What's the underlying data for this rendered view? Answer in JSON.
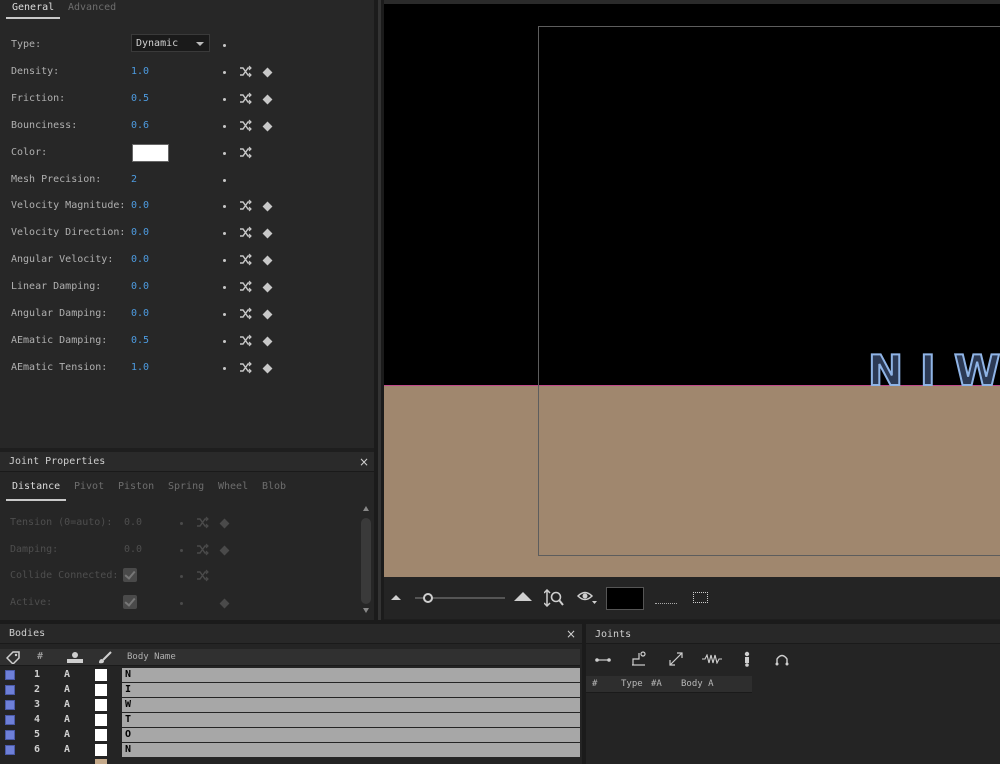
{
  "general_panel": {
    "tabs": [
      {
        "label": "General",
        "active": true
      },
      {
        "label": "Advanced",
        "active": false
      }
    ],
    "properties": [
      {
        "label": "Type:",
        "kind": "select",
        "value": "Dynamic",
        "shuffle": false,
        "keyframe": false
      },
      {
        "label": "Density:",
        "kind": "number",
        "value": "1.0",
        "shuffle": true,
        "keyframe": true
      },
      {
        "label": "Friction:",
        "kind": "number",
        "value": "0.5",
        "shuffle": true,
        "keyframe": true
      },
      {
        "label": "Bounciness:",
        "kind": "number",
        "value": "0.6",
        "shuffle": true,
        "keyframe": true
      },
      {
        "label": "Color:",
        "kind": "color",
        "value": "#ffffff",
        "shuffle": true,
        "keyframe": false
      },
      {
        "label": "Mesh Precision:",
        "kind": "number",
        "value": "2",
        "shuffle": false,
        "keyframe": false
      },
      {
        "label": "Velocity Magnitude:",
        "kind": "number",
        "value": "0.0",
        "shuffle": true,
        "keyframe": true
      },
      {
        "label": "Velocity Direction:",
        "kind": "number",
        "value": "0.0",
        "shuffle": true,
        "keyframe": true
      },
      {
        "label": "Angular Velocity:",
        "kind": "number",
        "value": "0.0",
        "shuffle": true,
        "keyframe": true
      },
      {
        "label": "Linear Damping:",
        "kind": "number",
        "value": "0.0",
        "shuffle": true,
        "keyframe": true
      },
      {
        "label": "Angular Damping:",
        "kind": "number",
        "value": "0.0",
        "shuffle": true,
        "keyframe": true
      },
      {
        "label": "AEmatic Damping:",
        "kind": "number",
        "value": "0.5",
        "shuffle": true,
        "keyframe": true
      },
      {
        "label": "AEmatic Tension:",
        "kind": "number",
        "value": "1.0",
        "shuffle": true,
        "keyframe": true
      }
    ]
  },
  "joint_panel": {
    "title": "Joint Properties",
    "close": "×",
    "tabs": [
      {
        "label": "Distance",
        "active": true
      },
      {
        "label": "Pivot",
        "active": false
      },
      {
        "label": "Piston",
        "active": false
      },
      {
        "label": "Spring",
        "active": false
      },
      {
        "label": "Wheel",
        "active": false
      },
      {
        "label": "Blob",
        "active": false
      }
    ],
    "properties": [
      {
        "label": "Tension (0=auto):",
        "kind": "number",
        "value": "0.0",
        "shuffle": true,
        "keyframe": true
      },
      {
        "label": "Damping:",
        "kind": "number",
        "value": "0.0",
        "shuffle": true,
        "keyframe": true
      },
      {
        "label": "Collide Connected:",
        "kind": "check",
        "value": "",
        "shuffle": true,
        "keyframe": false
      },
      {
        "label": "Active:",
        "kind": "check",
        "value": "",
        "shuffle": false,
        "keyframe": true
      }
    ]
  },
  "viewport": {
    "letters": [
      "N",
      "I",
      "W"
    ],
    "ground_color": "#a0876e",
    "letter_stroke": "#8fb4e6",
    "background_swatch": "#000000"
  },
  "bodies_panel": {
    "title": "Bodies",
    "close": "×",
    "columns": {
      "number": "#",
      "body_name": "Body Name"
    },
    "rows": [
      {
        "num": "1",
        "type": "A",
        "name": "N"
      },
      {
        "num": "2",
        "type": "A",
        "name": "I"
      },
      {
        "num": "3",
        "type": "A",
        "name": "W"
      },
      {
        "num": "4",
        "type": "A",
        "name": "T"
      },
      {
        "num": "5",
        "type": "A",
        "name": "O"
      },
      {
        "num": "6",
        "type": "A",
        "name": "N"
      }
    ],
    "body_color": "#6e80d8"
  },
  "joints_panel": {
    "title": "Joints",
    "columns": [
      "#",
      "Type",
      "#A",
      "Body A"
    ]
  }
}
